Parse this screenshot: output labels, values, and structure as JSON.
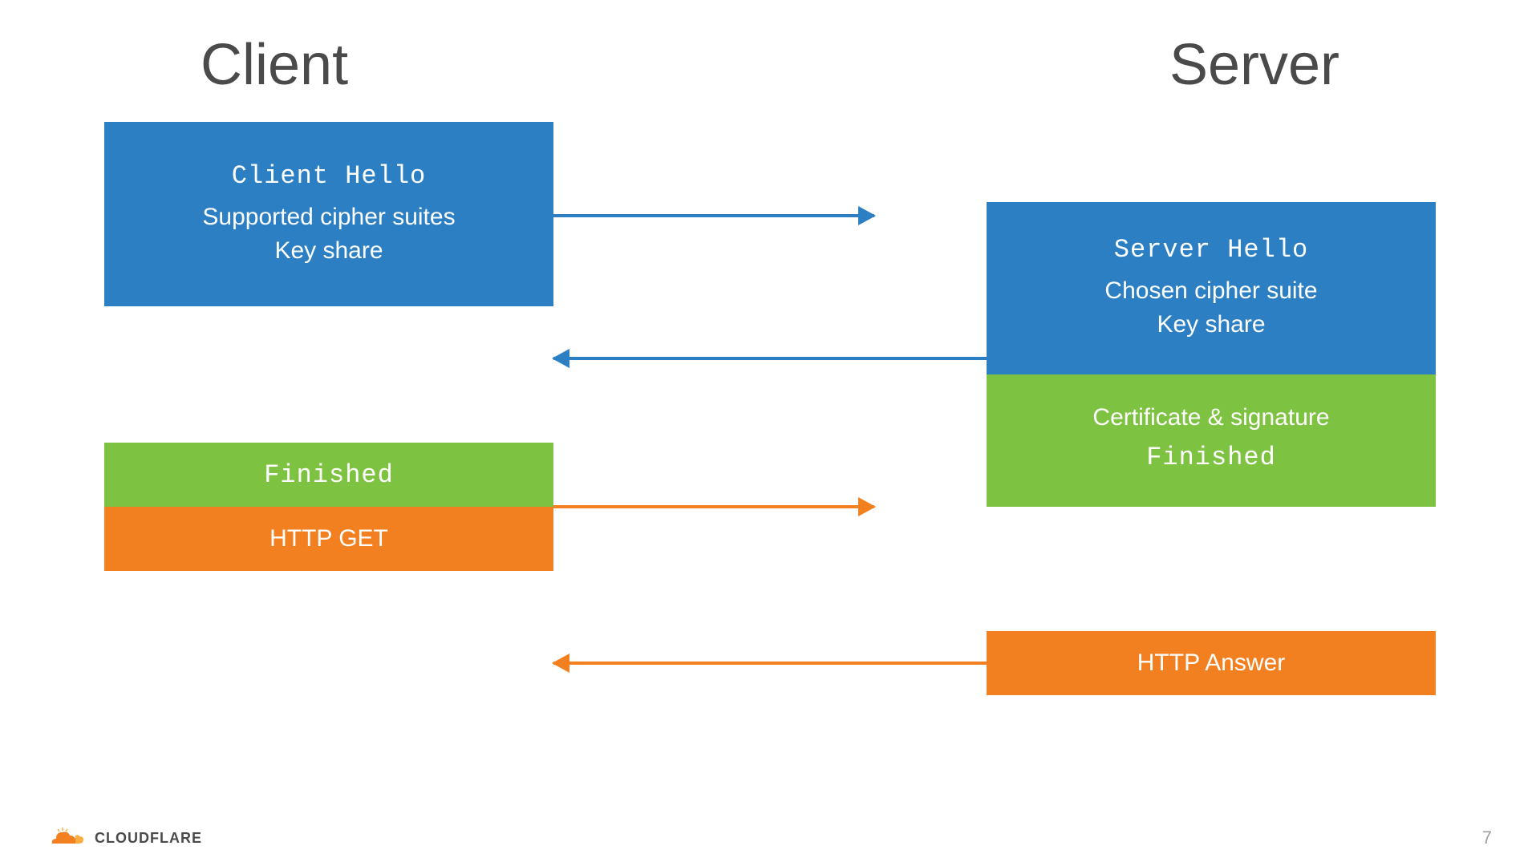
{
  "header": {
    "client": "Client",
    "server": "Server"
  },
  "client_hello": {
    "title": "Client Hello",
    "line1": "Supported cipher suites",
    "line2": "Key share"
  },
  "server_hello": {
    "title": "Server Hello",
    "line1": "Chosen cipher suite",
    "line2": "Key share"
  },
  "server_cert": {
    "line1": "Certificate & signature",
    "line2": "Finished"
  },
  "client_finished": "Finished",
  "client_get": "HTTP GET",
  "server_answer": "HTTP Answer",
  "footer": {
    "brand": "CLOUDFLARE",
    "page": "7"
  },
  "colors": {
    "blue": "#2b7fc2",
    "green": "#7ec242",
    "orange": "#f38020"
  }
}
